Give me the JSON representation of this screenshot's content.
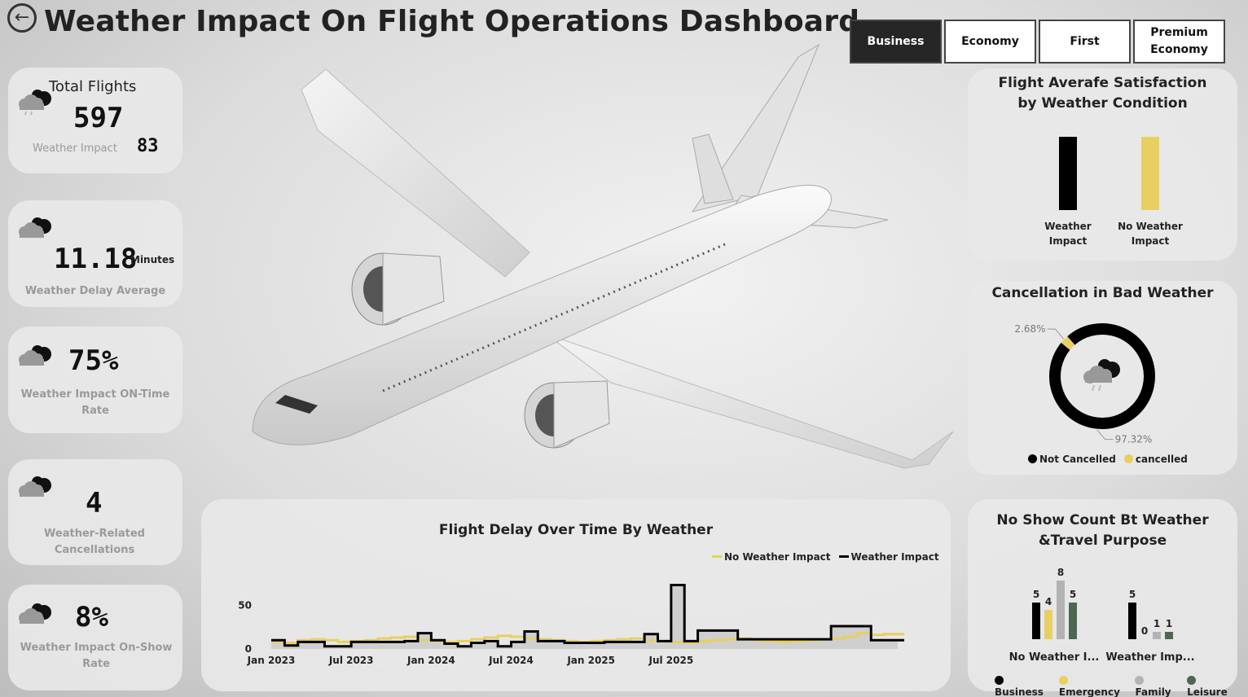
{
  "header": {
    "title": "Weather Impact On Flight Operations Dashboard",
    "back_icon": "arrow-left-circle-icon"
  },
  "slicer": {
    "options": [
      "Business",
      "Economy",
      "First",
      "Premium Economy"
    ],
    "selected": "Business"
  },
  "kpis": {
    "total_flights": {
      "label": "Total Flights",
      "value": "597",
      "sub_label": "Weather Impact",
      "sub_value": "83"
    },
    "delay": {
      "value": "11.18",
      "unit": "Minutes",
      "label": "Weather Delay Average"
    },
    "on_time": {
      "value": "75%",
      "label": "Weather Impact ON-Time Rate"
    },
    "cancellations": {
      "value": "4",
      "label": "Weather-Related Cancellations"
    },
    "no_show": {
      "value": "8%",
      "label": "Weather Impact On-Show Rate"
    }
  },
  "colors": {
    "black": "#000000",
    "yellow": "#E8CF62",
    "grey": "#B3B3B3",
    "green": "#4F6652"
  },
  "satisfaction": {
    "title": "Flight Averafe Satisfaction by Weather Condition",
    "chart_data": {
      "type": "bar",
      "categories": [
        "Weather Impact",
        "No Weather Impact"
      ],
      "values": [
        1.0,
        1.0
      ],
      "colors": [
        "#000000",
        "#E8CF62"
      ]
    }
  },
  "cancellation": {
    "title": "Cancellation in Bad Weather",
    "chart_data": {
      "type": "pie",
      "labels": [
        "Not Cancelled",
        "cancelled"
      ],
      "values": [
        97.32,
        2.68
      ],
      "data_labels": [
        "97.32%",
        "2.68%"
      ],
      "colors": [
        "#000000",
        "#E8CF62"
      ]
    }
  },
  "delay_chart": {
    "title": "Flight Delay Over Time By Weather",
    "chart_data": {
      "type": "line",
      "x_ticks": [
        "Jan 2023",
        "Jul 2023",
        "Jan 2024",
        "Jul 2024",
        "Jan 2025",
        "Jul 2025"
      ],
      "y_ticks": [
        "0",
        "50"
      ],
      "ylim": [
        0,
        80
      ],
      "x_start": "2023-01",
      "series": [
        {
          "name": "No Weather Impact",
          "color": "#E8CF62",
          "values": [
            8,
            7,
            10,
            11,
            10,
            8,
            9,
            10,
            12,
            13,
            14,
            10,
            9,
            8,
            9,
            11,
            13,
            15,
            14,
            12,
            11,
            10,
            9,
            8,
            9,
            10,
            11,
            12,
            10,
            9,
            8,
            7,
            9,
            10,
            11,
            12,
            10,
            9,
            8,
            9,
            10,
            11,
            12,
            14,
            18,
            16,
            17,
            17
          ]
        },
        {
          "name": "Weather Impact",
          "color": "#000000",
          "values": [
            10,
            4,
            8,
            8,
            3,
            3,
            8,
            8,
            8,
            8,
            9,
            18,
            10,
            6,
            3,
            7,
            9,
            3,
            8,
            20,
            9,
            9,
            7,
            7,
            7,
            8,
            8,
            8,
            17,
            9,
            73,
            9,
            21,
            21,
            21,
            11,
            11,
            11,
            11,
            11,
            11,
            11,
            26,
            26,
            26,
            10,
            10,
            10
          ]
        }
      ]
    }
  },
  "noshow": {
    "title": "No Show Count Bt Weather &Travel Purpose",
    "chart_data": {
      "type": "bar",
      "categories": [
        "No Weather I...",
        "Weather Imp..."
      ],
      "series": [
        {
          "name": "Business",
          "color": "#000000",
          "values": [
            5,
            5
          ]
        },
        {
          "name": "Emergency",
          "color": "#E8CF62",
          "values": [
            4,
            0
          ]
        },
        {
          "name": "Family",
          "color": "#B3B3B3",
          "values": [
            8,
            1
          ]
        },
        {
          "name": "Leisure",
          "color": "#4F6652",
          "values": [
            5,
            1
          ]
        }
      ]
    }
  }
}
